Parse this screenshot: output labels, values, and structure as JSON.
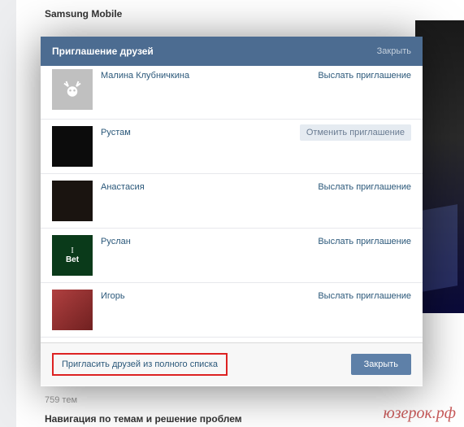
{
  "page": {
    "title": "Samsung Mobile",
    "topic_count": "759 тем",
    "nav_text": "Навигация по темам и решение проблем",
    "watermark": "юзерок.рф"
  },
  "modal": {
    "title": "Приглашение друзей",
    "close_top": "Закрыть",
    "full_list_link": "Пригласить друзей из полного списка",
    "close_btn": "Закрыть"
  },
  "friends": [
    {
      "name": "Малина Клубничкина",
      "action": "Выслать приглашение",
      "status": "default",
      "avatar": "deer"
    },
    {
      "name": "Рустам",
      "action": "Отменить приглашение",
      "status": "sent",
      "avatar": "dark"
    },
    {
      "name": "Анастасия",
      "action": "Выслать приглашение",
      "status": "default",
      "avatar": "dark2"
    },
    {
      "name": "Руслан",
      "action": "Выслать приглашение",
      "status": "default",
      "avatar": "green"
    },
    {
      "name": "Игорь",
      "action": "Выслать приглашение",
      "status": "default",
      "avatar": "red"
    }
  ]
}
